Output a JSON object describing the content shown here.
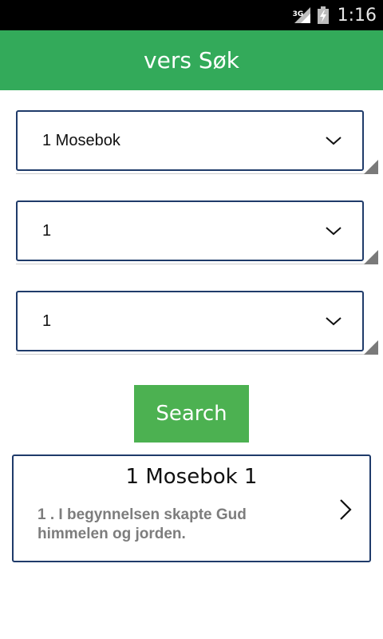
{
  "status_bar": {
    "network": "3G",
    "time": "1:16",
    "icons": [
      "signal-icon",
      "battery-icon"
    ]
  },
  "app_bar": {
    "title": "vers Søk"
  },
  "selects": {
    "book": {
      "value": "1 Mosebok"
    },
    "chapter": {
      "value": "1"
    },
    "verse": {
      "value": "1"
    }
  },
  "search_button": {
    "label": "Search"
  },
  "result": {
    "title": "1 Mosebok 1",
    "text": "1 . I begynnelsen skapte Gud himmelen og jorden."
  },
  "colors": {
    "app_bar": "#33aa5a",
    "button": "#4cb151",
    "border": "#1f3b6a",
    "result_text": "#7d7d7d"
  }
}
